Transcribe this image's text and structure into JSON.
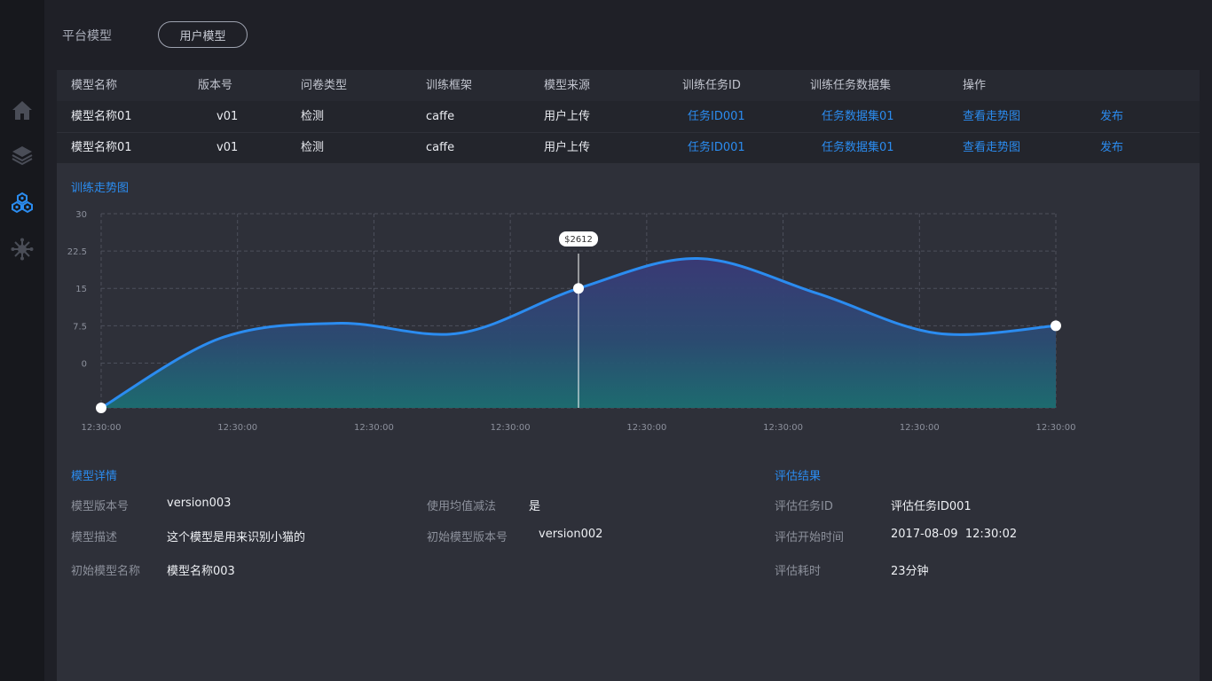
{
  "header": {
    "tabs": [
      {
        "label": "平台模型",
        "active": false
      },
      {
        "label": "用户模型",
        "active": true
      }
    ]
  },
  "sidebar": {
    "items": [
      {
        "icon": "home-icon"
      },
      {
        "icon": "layers-icon"
      },
      {
        "icon": "model-cluster-icon",
        "active": true
      },
      {
        "icon": "network-icon"
      }
    ]
  },
  "table": {
    "columns": [
      "模型名称",
      "版本号",
      "问卷类型",
      "训练框架",
      "模型来源",
      "训练任务ID",
      "训练任务数据集",
      "操作"
    ],
    "rows": [
      {
        "name": "模型名称01",
        "version": "v01",
        "survey_type": "检测",
        "framework": "caffe",
        "source": "用户上传",
        "task_id": "任务ID001",
        "dataset": "任务数据集01",
        "action_view": "查看走势图",
        "action_publish": "发布"
      },
      {
        "name": "模型名称01",
        "version": "v01",
        "survey_type": "检测",
        "framework": "caffe",
        "source": "用户上传",
        "task_id": "任务ID001",
        "dataset": "任务数据集01",
        "action_view": "查看走势图",
        "action_publish": "发布"
      }
    ]
  },
  "trend": {
    "title": "训练走势图"
  },
  "chart_data": {
    "type": "area",
    "x": [
      "12:30:00",
      "12:30:00",
      "12:30:00",
      "12:30:00",
      "12:30:00",
      "12:30:00",
      "12:30:00",
      "12:30:00"
    ],
    "values": [
      -9,
      5,
      8,
      6,
      15,
      21,
      14,
      6,
      7.5
    ],
    "y_ticks": [
      "30",
      "22.5",
      "15",
      "7.5",
      "0"
    ],
    "ylim": [
      -9,
      30
    ],
    "grid": true,
    "line_color": "#2b8cf0",
    "tooltip": {
      "text": "$2612"
    }
  },
  "details": {
    "title": "模型详情",
    "fields": {
      "model_version": {
        "label": "模型版本号",
        "value": "version003"
      },
      "mean_subtraction": {
        "label": "使用均值减法",
        "value": "是"
      },
      "description": {
        "label": "模型描述",
        "value": "这个模型是用来识别小猫的"
      },
      "initial_version": {
        "label": "初始模型版本号",
        "value": "version002"
      },
      "initial_name": {
        "label": "初始模型名称",
        "value": "模型名称003"
      }
    }
  },
  "evaluation": {
    "title": "评估结果",
    "fields": {
      "task_id": {
        "label": "评估任务ID",
        "value": "评估任务ID001"
      },
      "start_time": {
        "label": "评估开始时间",
        "value": "2017-08-09  12:30:02"
      },
      "duration": {
        "label": "评估耗时",
        "value": "23分钟"
      }
    }
  },
  "colors": {
    "accent": "#2b8cf0",
    "background": "#1f2027",
    "panel": "#2e3039",
    "sidebar": "#17181d"
  }
}
